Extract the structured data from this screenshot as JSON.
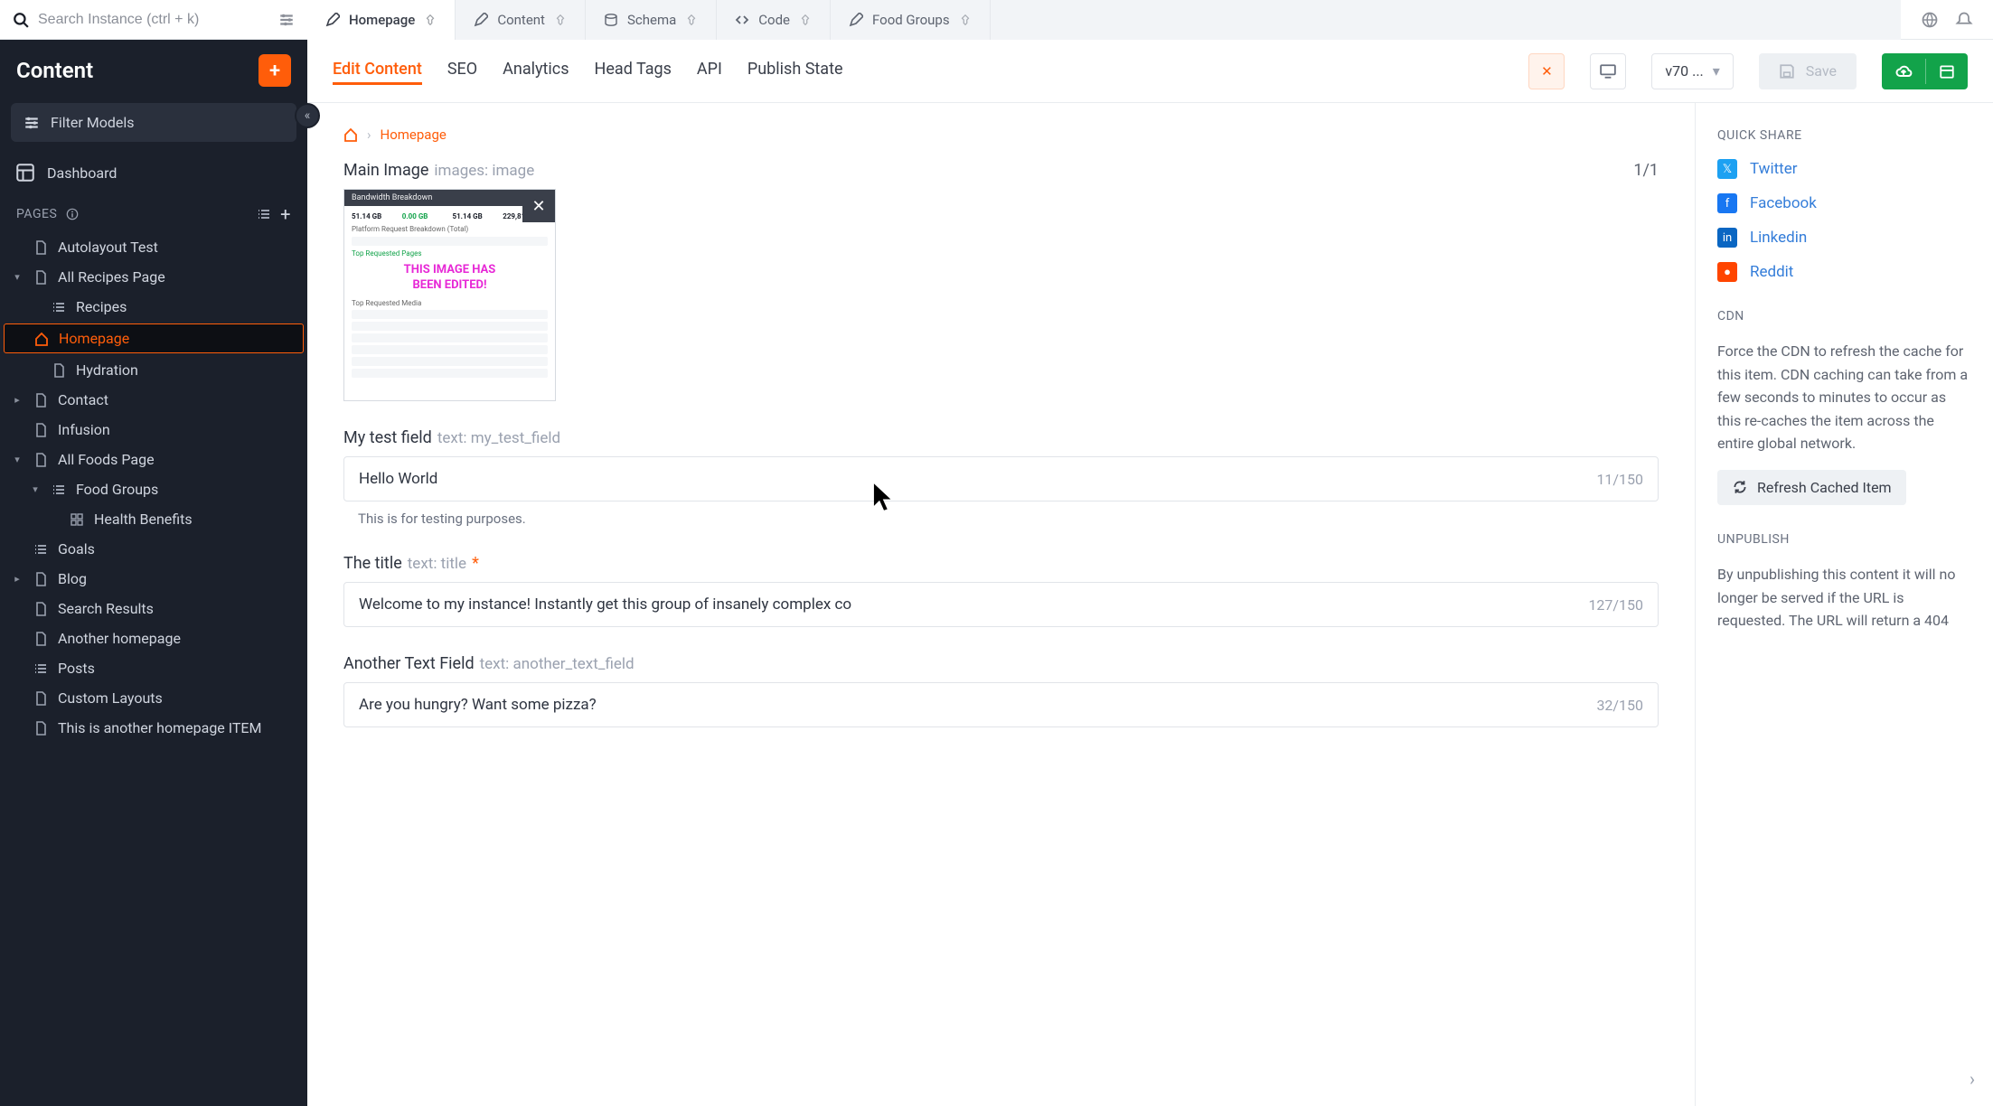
{
  "search": {
    "placeholder": "Search Instance (ctrl + k)"
  },
  "tabs": [
    {
      "label": "Homepage",
      "icon": "pencil"
    },
    {
      "label": "Content",
      "icon": "pencil"
    },
    {
      "label": "Schema",
      "icon": "db"
    },
    {
      "label": "Code",
      "icon": "code"
    },
    {
      "label": "Food Groups",
      "icon": "pencil"
    }
  ],
  "sidebar": {
    "title": "Content",
    "filter_label": "Filter Models",
    "dashboard_label": "Dashboard",
    "pages_heading": "PAGES",
    "items": [
      {
        "label": "Autolayout Test",
        "icon": "doc",
        "indent": 0,
        "chev": ""
      },
      {
        "label": "All Recipes Page",
        "icon": "doc",
        "indent": 0,
        "chev": "down"
      },
      {
        "label": "Recipes",
        "icon": "list",
        "indent": 1,
        "chev": ""
      },
      {
        "label": "Homepage",
        "icon": "home",
        "indent": 1,
        "chev": "",
        "selected": true
      },
      {
        "label": "Hydration",
        "icon": "doc",
        "indent": 1,
        "chev": ""
      },
      {
        "label": "Contact",
        "icon": "doc",
        "indent": 0,
        "chev": "right"
      },
      {
        "label": "Infusion",
        "icon": "doc",
        "indent": 0,
        "chev": ""
      },
      {
        "label": "All Foods Page",
        "icon": "doc",
        "indent": 0,
        "chev": "down"
      },
      {
        "label": "Food Groups",
        "icon": "list",
        "indent": 1,
        "chev": "down"
      },
      {
        "label": "Health Benefits",
        "icon": "grid",
        "indent": 2,
        "chev": ""
      },
      {
        "label": "Goals",
        "icon": "list",
        "indent": 0,
        "chev": ""
      },
      {
        "label": "Blog",
        "icon": "doc",
        "indent": 0,
        "chev": "right"
      },
      {
        "label": "Search Results",
        "icon": "doc",
        "indent": 0,
        "chev": ""
      },
      {
        "label": "Another homepage",
        "icon": "doc",
        "indent": 0,
        "chev": ""
      },
      {
        "label": "Posts",
        "icon": "list",
        "indent": 0,
        "chev": ""
      },
      {
        "label": "Custom Layouts",
        "icon": "doc",
        "indent": 0,
        "chev": ""
      },
      {
        "label": "This is another homepage ITEM",
        "icon": "doc",
        "indent": 0,
        "chev": ""
      }
    ]
  },
  "subtabs": [
    "Edit Content",
    "SEO",
    "Analytics",
    "Head Tags",
    "API",
    "Publish State"
  ],
  "actions": {
    "version": "v70 ...",
    "save": "Save"
  },
  "breadcrumb": {
    "page": "Homepage"
  },
  "fields": {
    "main_image": {
      "label": "Main Image",
      "meta": "images: image",
      "count": "1/1",
      "thumb_overlay_l1": "THIS IMAGE HAS",
      "thumb_overlay_l2": "BEEN EDITED!"
    },
    "my_test": {
      "label": "My test field",
      "meta": "text: my_test_field",
      "value": "Hello World",
      "count": "11/150",
      "help": "This is for testing purposes."
    },
    "title": {
      "label": "The title",
      "meta": "text: title",
      "required": true,
      "value": "Welcome to my instance! Instantly get this group of insanely complex co",
      "count": "127/150"
    },
    "another": {
      "label": "Another Text Field",
      "meta": "text: another_text_field",
      "value": "Are you hungry? Want some pizza?",
      "count": "32/150"
    }
  },
  "rightpanel": {
    "quick_share": "QUICK SHARE",
    "share": {
      "twitter": "Twitter",
      "facebook": "Facebook",
      "linkedin": "Linkedin",
      "reddit": "Reddit"
    },
    "cdn_heading": "CDN",
    "cdn_text": "Force the CDN to refresh the cache for this item. CDN caching can take from a few seconds to minutes to occur as this re-caches the item across the entire global network.",
    "cdn_btn": "Refresh Cached Item",
    "unpub_heading": "UNPUBLISH",
    "unpub_text": "By unpublishing this content it will no longer be served if the URL is requested. The URL will return a 404"
  }
}
